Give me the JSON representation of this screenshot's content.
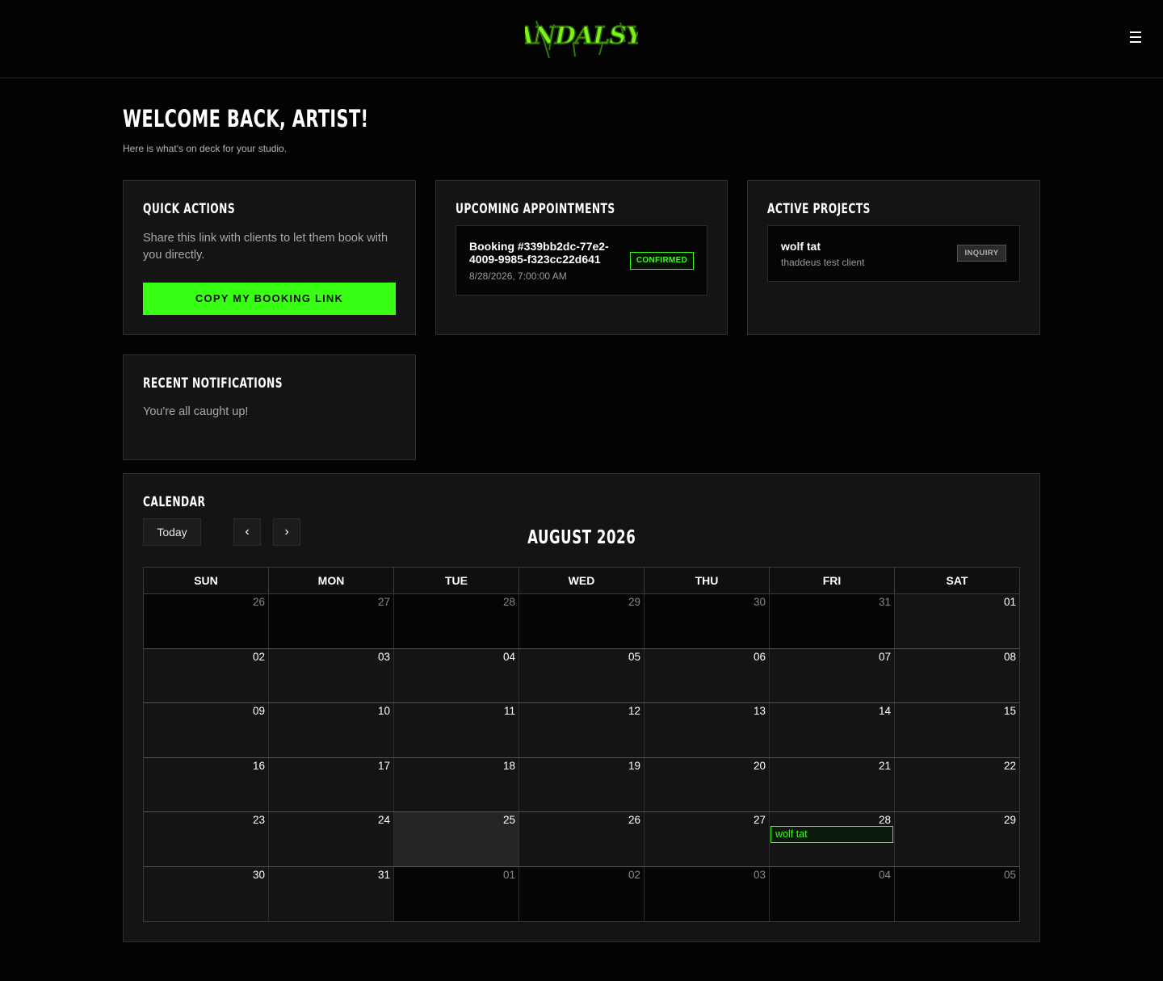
{
  "header": {
    "logo_text": "VANDALSYN",
    "menu_icon": "hamburger-menu-icon"
  },
  "welcome": {
    "title": "WELCOME BACK, ARTIST!",
    "subtitle": "Here is what's on deck for your studio."
  },
  "quick_actions": {
    "title": "QUICK ACTIONS",
    "description": "Share this link with clients to let them book with you directly.",
    "button_label": "COPY MY BOOKING LINK"
  },
  "upcoming_appointments": {
    "title": "UPCOMING APPOINTMENTS",
    "items": [
      {
        "title": "Booking #339bb2dc-77e2-4009-9985-f323cc22d641",
        "datetime": "8/28/2026, 7:00:00 AM",
        "status": "CONFIRMED"
      }
    ]
  },
  "active_projects": {
    "title": "ACTIVE PROJECTS",
    "items": [
      {
        "name": "wolf tat",
        "client": "thaddeus test client",
        "status": "INQUIRY"
      }
    ]
  },
  "notifications": {
    "title": "RECENT NOTIFICATIONS",
    "empty_text": "You're all caught up!"
  },
  "calendar": {
    "title": "CALENDAR",
    "today_label": "Today",
    "prev_label": "‹",
    "next_label": "›",
    "month_label": "AUGUST 2026",
    "weekdays": [
      "SUN",
      "MON",
      "TUE",
      "WED",
      "THU",
      "FRI",
      "SAT"
    ],
    "weeks": [
      [
        "26",
        "27",
        "28",
        "29",
        "30",
        "31",
        "01"
      ],
      [
        "02",
        "03",
        "04",
        "05",
        "06",
        "07",
        "08"
      ],
      [
        "09",
        "10",
        "11",
        "12",
        "13",
        "14",
        "15"
      ],
      [
        "16",
        "17",
        "18",
        "19",
        "20",
        "21",
        "22"
      ],
      [
        "23",
        "24",
        "25",
        "26",
        "27",
        "28",
        "29"
      ],
      [
        "30",
        "31",
        "01",
        "02",
        "03",
        "04",
        "05"
      ]
    ],
    "event": {
      "label": "wolf tat",
      "date": "28"
    },
    "colors": {
      "accent": "#39ff14",
      "background": "#030303",
      "card": "#141414"
    }
  }
}
